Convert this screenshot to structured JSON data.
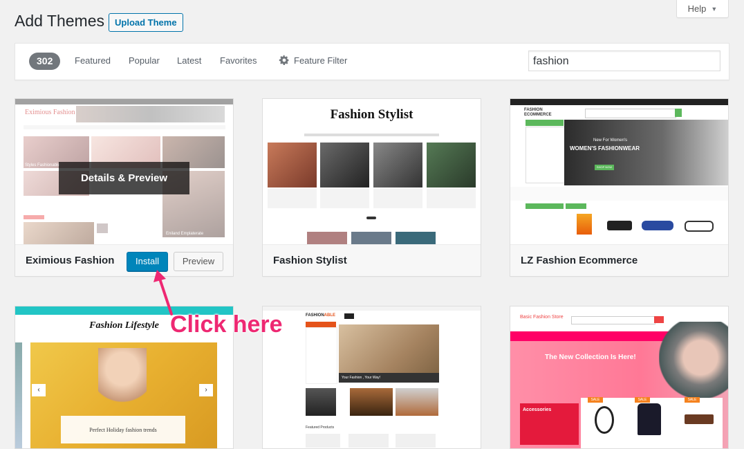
{
  "header": {
    "title": "Add Themes",
    "upload_label": "Upload Theme",
    "help_label": "Help"
  },
  "filter": {
    "count": "302",
    "tabs": [
      "Featured",
      "Popular",
      "Latest",
      "Favorites"
    ],
    "feature_filter": "Feature Filter",
    "search_value": "fashion"
  },
  "themes": [
    {
      "name": "Eximious Fashion",
      "install_label": "Install",
      "preview_label": "Preview",
      "overlay_label": "Details & Preview",
      "shot": {
        "logo": "Eximious Fashion",
        "caption_1": "Styles Fashionable",
        "caption_2": "Eniland Emplaterate"
      }
    },
    {
      "name": "Fashion Stylist",
      "shot": {
        "logo": "Fashion Stylist"
      }
    },
    {
      "name": "LZ Fashion Ecommerce",
      "shot": {
        "logo_top": "FASHION",
        "logo_bottom": "ECOMMERCE",
        "hero_small": "New For Women's",
        "hero_big": "WOMEN'S FASHIONWEAR",
        "hero_btn": "SHOP NOW"
      }
    },
    {
      "name": "Fashion Lifestyle",
      "shot": {
        "logo": "Fashion Lifestyle",
        "post": "Perfect Holiday fashion trends"
      }
    },
    {
      "name": "Fashionable",
      "shot": {
        "logo_a": "FASHION",
        "logo_b": "ABLE",
        "banner": "Your Fashion , Your Way!",
        "featured": "Featured Products"
      }
    },
    {
      "name": "Basic Fashion Store",
      "shot": {
        "logo": "Basic Fashion Store",
        "hero": "The New Collection Is Here!",
        "promo_title": "Accessories",
        "sale": "SALE"
      }
    }
  ],
  "annotation": {
    "text": "Click here"
  },
  "colors": {
    "accent": "#0085ba",
    "annotation": "#ee2872"
  }
}
